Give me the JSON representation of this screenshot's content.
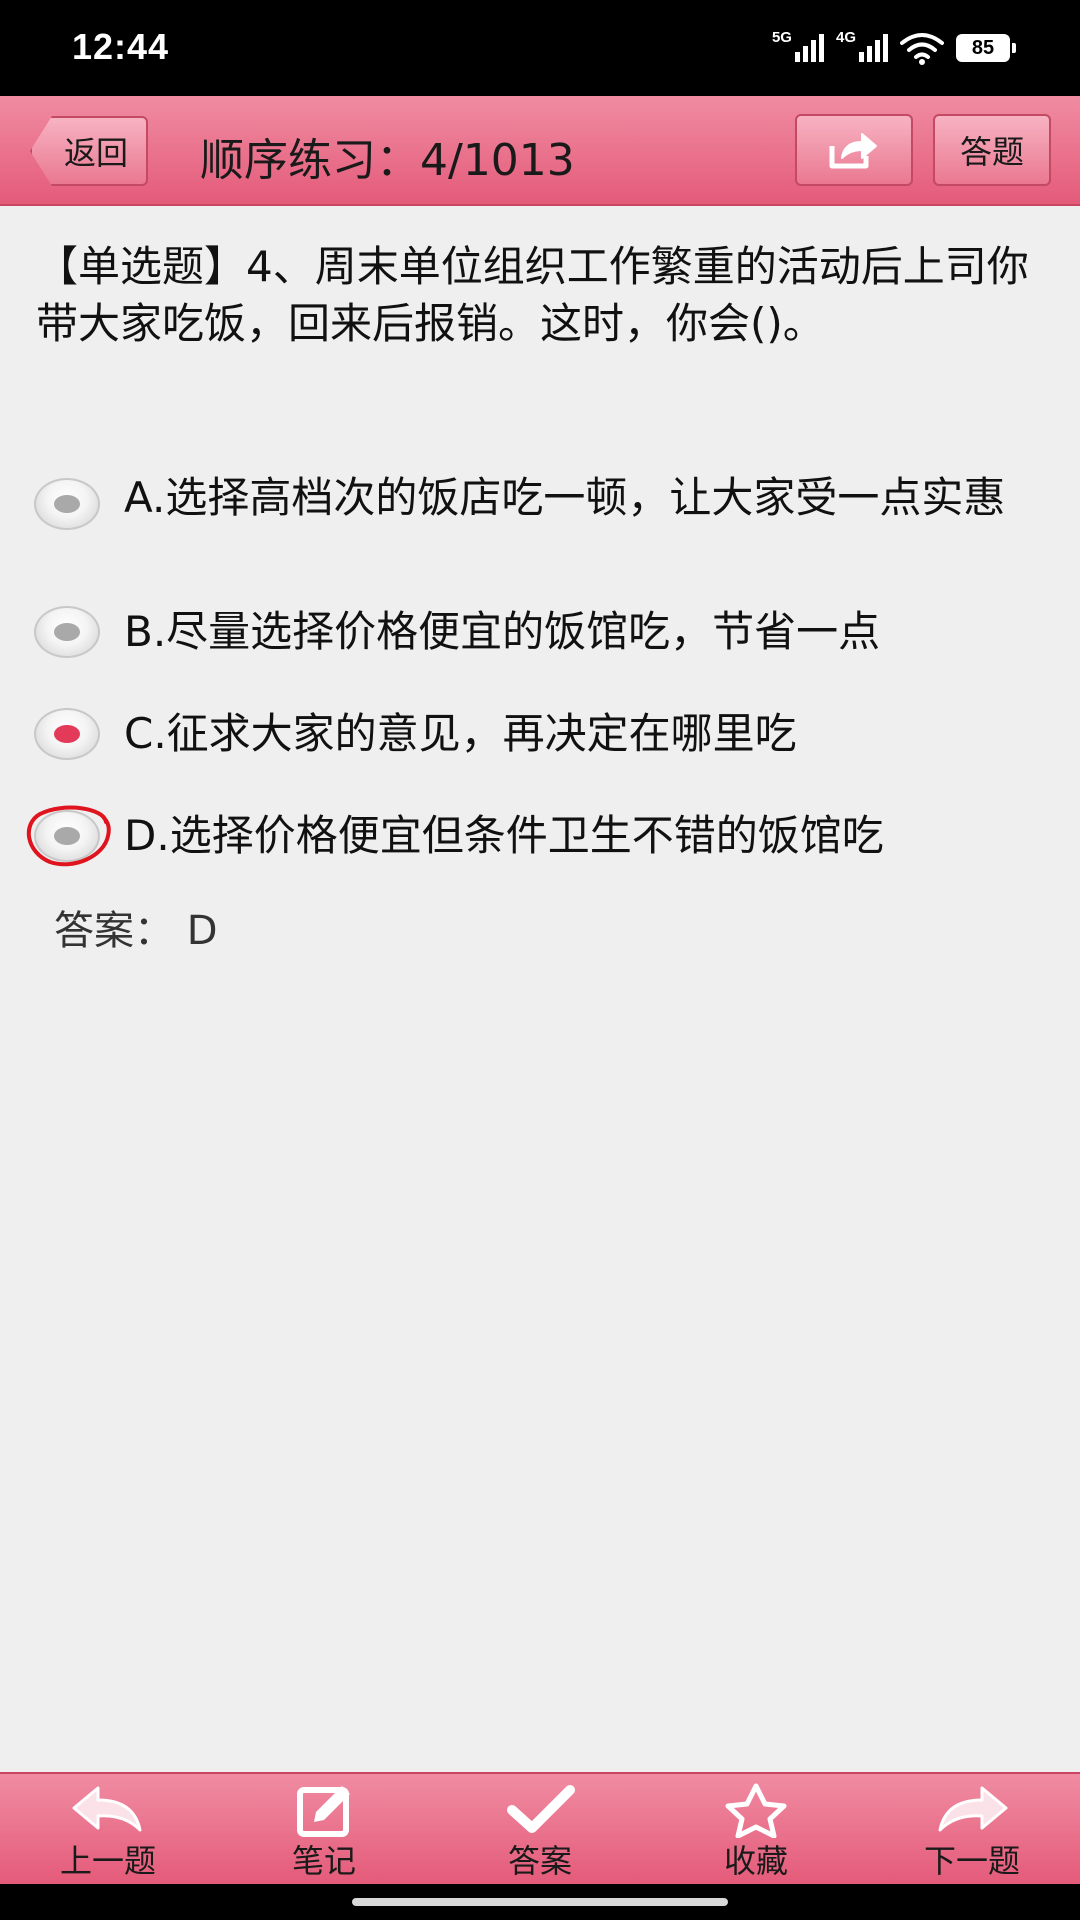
{
  "status_bar": {
    "time": "12:44",
    "network_1": "5G",
    "network_2": "4G",
    "battery": "85",
    "icons": [
      "signal-icon",
      "wifi-icon",
      "battery-icon"
    ]
  },
  "header": {
    "back_label": "返回",
    "title": "顺序练习：4/1013",
    "share_icon": "share-icon",
    "answer_sheet_label": "答题"
  },
  "question": {
    "text": "【单选题】4、周末单位组织工作繁重的活动后上司你带大家吃饭，回来后报销。这时，你会()。",
    "options": [
      {
        "label": "A.选择高档次的饭店吃一顿，让大家受一点实惠",
        "selected": false
      },
      {
        "label": "B.尽量选择价格便宜的饭馆吃，节省一点",
        "selected": false
      },
      {
        "label": "C.征求大家的意见，再决定在哪里吃",
        "selected": true
      },
      {
        "label": "D.选择价格便宜但条件卫生不错的饭馆吃",
        "selected": false
      }
    ],
    "answer_text": "答案：  D"
  },
  "bottom_nav": {
    "items": [
      {
        "label": "上一题",
        "icon": "back-arrow-icon"
      },
      {
        "label": "笔记",
        "icon": "edit-note-icon"
      },
      {
        "label": "答案",
        "icon": "checkmark-icon"
      },
      {
        "label": "收藏",
        "icon": "star-icon"
      },
      {
        "label": "下一题",
        "icon": "forward-arrow-icon"
      }
    ]
  },
  "colors": {
    "accent": "#e45b7a",
    "selected_dot": "#e23a58",
    "annotation_circle": "#e0141e"
  }
}
